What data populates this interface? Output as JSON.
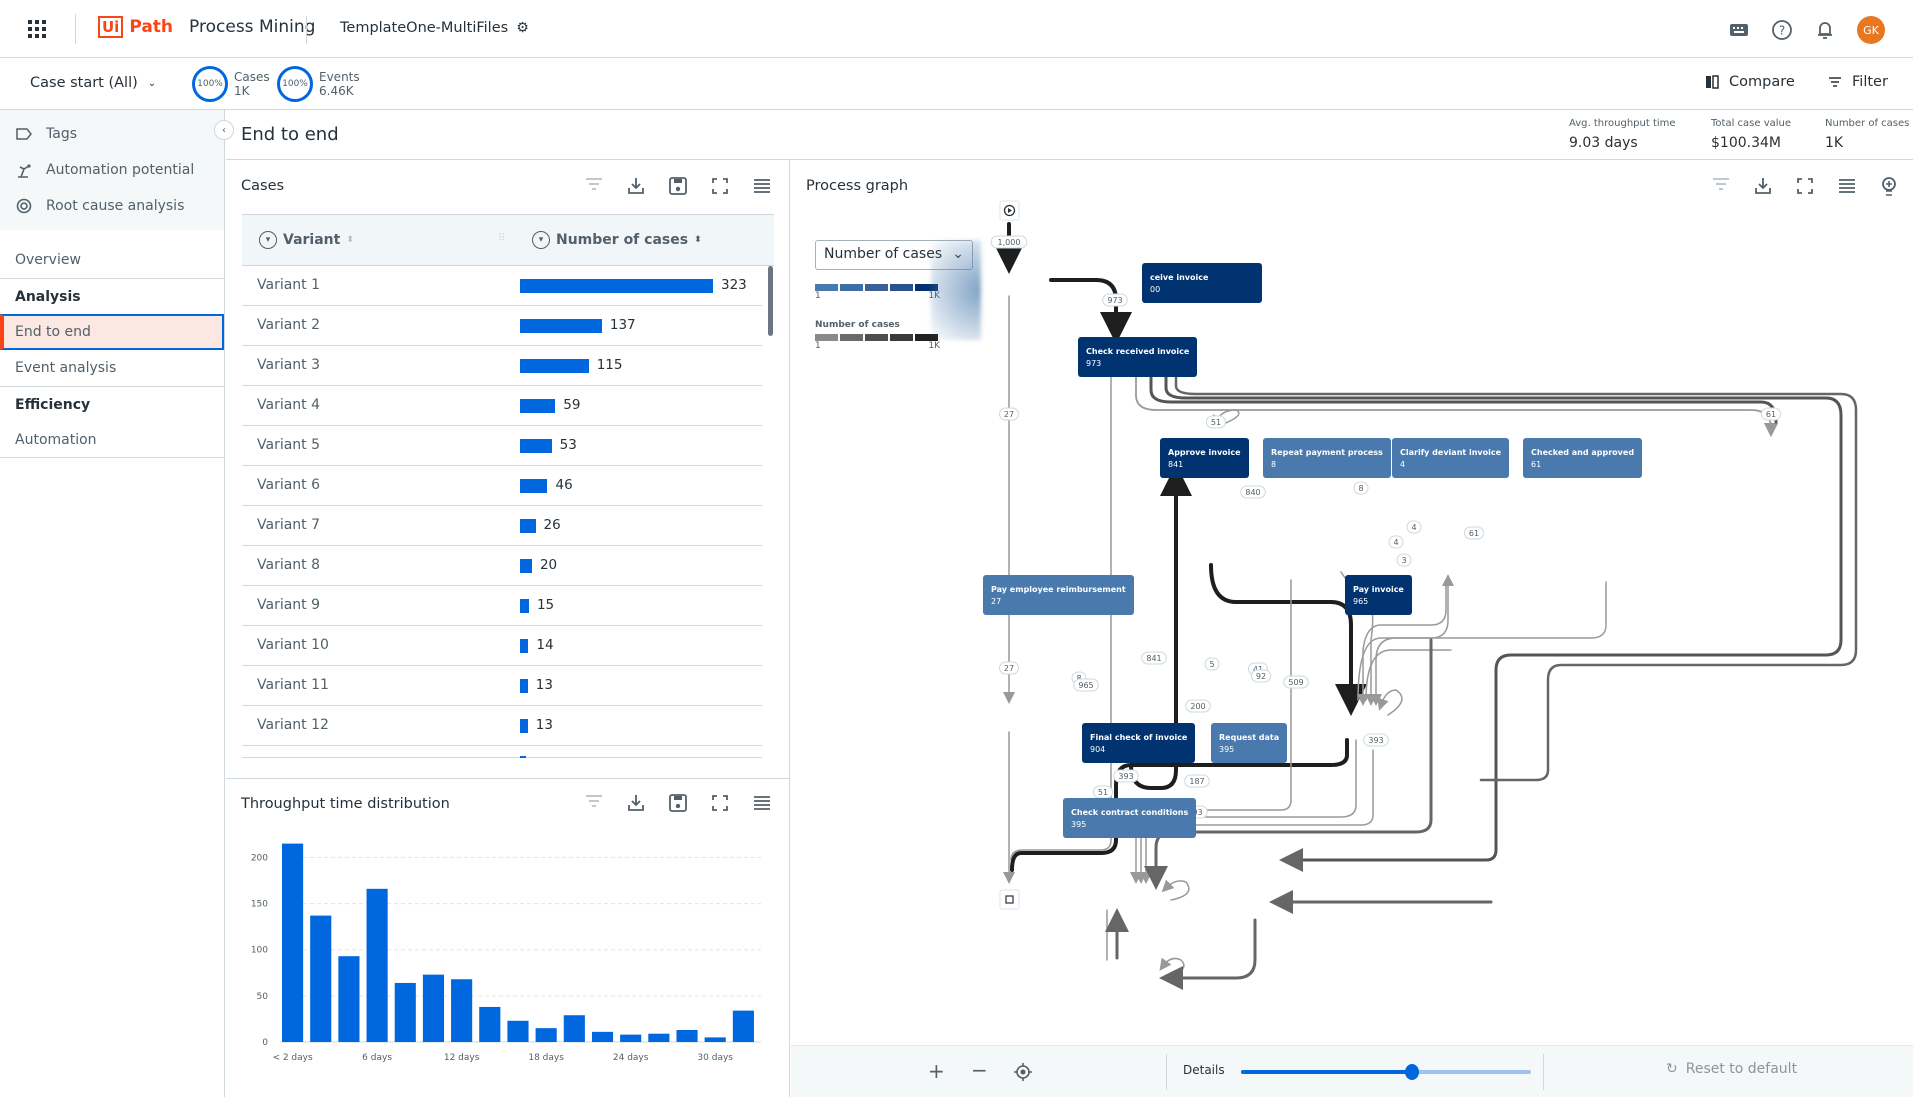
{
  "topbar": {
    "app_brand": "UiPath",
    "app_brand_box": "Ui",
    "app_brand_rest": "Path",
    "product": "Process Mining",
    "project": "TemplateOne-MultiFiles",
    "avatar_initials": "GK"
  },
  "subbar": {
    "case_start": "Case start (All)",
    "cases_pct": "100%",
    "cases_label": "Cases",
    "cases_value": "1K",
    "events_pct": "100%",
    "events_label": "Events",
    "events_value": "6.46K",
    "compare": "Compare",
    "filter": "Filter"
  },
  "sidebar": {
    "tools": [
      {
        "label": "Tags",
        "icon": "tag-icon"
      },
      {
        "label": "Automation potential",
        "icon": "robot-icon"
      },
      {
        "label": "Root cause analysis",
        "icon": "target-icon"
      }
    ],
    "overview": "Overview",
    "analysis_head": "Analysis",
    "end_to_end": "End to end",
    "event_analysis": "Event analysis",
    "efficiency_head": "Efficiency",
    "automation": "Automation"
  },
  "page": {
    "title": "End to end",
    "stats": [
      {
        "label": "Avg. throughput time",
        "value": "9.03 days"
      },
      {
        "label": "Total case value",
        "value": "$100.34M"
      },
      {
        "label": "Number of cases",
        "value": "1K"
      }
    ]
  },
  "cases": {
    "title": "Cases",
    "col_variant": "Variant",
    "col_count": "Number of cases",
    "max": 323,
    "rows": [
      {
        "name": "Variant 1",
        "value": 323
      },
      {
        "name": "Variant 2",
        "value": 137
      },
      {
        "name": "Variant 3",
        "value": 115
      },
      {
        "name": "Variant 4",
        "value": 59
      },
      {
        "name": "Variant 5",
        "value": 53
      },
      {
        "name": "Variant 6",
        "value": 46
      },
      {
        "name": "Variant 7",
        "value": 26
      },
      {
        "name": "Variant 8",
        "value": 20
      },
      {
        "name": "Variant 9",
        "value": 15
      },
      {
        "name": "Variant 10",
        "value": 14
      },
      {
        "name": "Variant 11",
        "value": 13
      },
      {
        "name": "Variant 12",
        "value": 13
      }
    ]
  },
  "chart_data": {
    "type": "bar",
    "title": "Throughput time distribution",
    "xlabel": "",
    "ylabel": "",
    "categories": [
      "< 2 days",
      "",
      "",
      "6 days",
      "",
      "",
      "12 days",
      "",
      "",
      "18 days",
      "",
      "",
      "24 days",
      "",
      "",
      "30 days",
      ""
    ],
    "x_tick_labels": [
      "< 2 days",
      "6 days",
      "12 days",
      "18 days",
      "24 days",
      "30 days"
    ],
    "values": [
      215,
      137,
      93,
      166,
      64,
      73,
      68,
      38,
      23,
      15,
      29,
      11,
      8,
      9,
      13,
      5,
      34
    ],
    "ylim": [
      0,
      220
    ],
    "yticks": [
      0,
      50,
      100,
      150,
      200
    ],
    "grid": true,
    "color": "#0067df"
  },
  "graph": {
    "title": "Process graph",
    "metric": "Number of cases",
    "legend1_min": "1",
    "legend1_max": "1K",
    "legend2_title": "Number of cases",
    "legend2_min": "1",
    "legend2_max": "1K",
    "nodes": [
      {
        "label": "ceive invoice",
        "count": "00"
      },
      {
        "label": "Check received invoice",
        "count": "973"
      },
      {
        "label": "Approve invoice",
        "count": "841"
      },
      {
        "label": "Repeat payment process",
        "count": "8"
      },
      {
        "label": "Clarify deviant invoice",
        "count": "4"
      },
      {
        "label": "Checked and approved",
        "count": "61"
      },
      {
        "label": "Pay employee reimbursement",
        "count": "27"
      },
      {
        "label": "Pay invoice",
        "count": "965"
      },
      {
        "label": "Final check of invoice",
        "count": "904"
      },
      {
        "label": "Request data",
        "count": "395"
      },
      {
        "label": "Check contract conditions",
        "count": "395"
      }
    ],
    "edge_labels": [
      "1,000",
      "973",
      "27",
      "61",
      "51",
      "840",
      "8",
      "4",
      "4",
      "3",
      "61",
      "27",
      "8",
      "965",
      "841",
      "5",
      "41",
      "92",
      "509",
      "200",
      "393",
      "393",
      "51",
      "187",
      "393"
    ],
    "details_label": "Details",
    "details_level": 0.59,
    "reset": "Reset to default"
  },
  "colors": {
    "accent": "#0067df",
    "brand": "#fa4616",
    "node_dark": "#003370",
    "node_mid": "#4a7aad"
  }
}
